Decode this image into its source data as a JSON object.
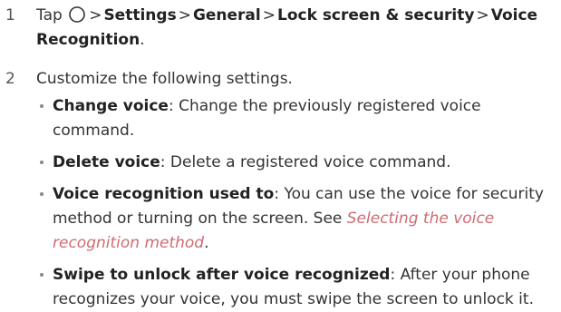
{
  "step1": {
    "number": "1",
    "tap": "Tap",
    "home_icon": "home-button-icon",
    "separator": ">",
    "path": [
      "Settings",
      "General",
      "Lock screen & security",
      "Voice Recognition"
    ],
    "period": "."
  },
  "step2": {
    "number": "2",
    "text": "Customize the following settings."
  },
  "bullets": [
    {
      "term": "Change voice",
      "desc": ": Change the previously registered voice command."
    },
    {
      "term": "Delete voice",
      "desc": ": Delete a registered voice command."
    },
    {
      "term": "Voice recognition used to",
      "desc": ": You can use the voice for security method or turning on the screen. See ",
      "link": "Selecting the voice recognition method",
      "after": "."
    },
    {
      "term": "Swipe to unlock after voice recognized",
      "desc": ": After your phone recognizes your voice, you must swipe the screen to unlock it."
    }
  ],
  "colors": {
    "text": "#333333",
    "link": "#d06a72"
  }
}
